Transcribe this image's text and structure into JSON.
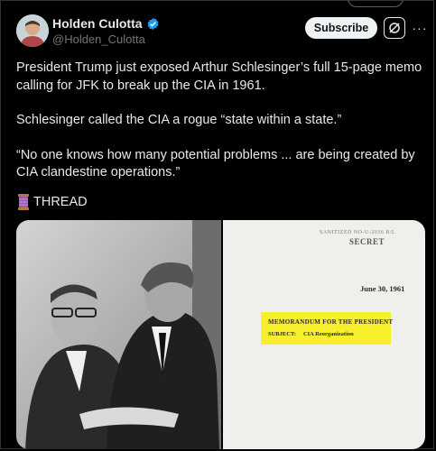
{
  "header": {
    "display_name": "Holden Culotta",
    "handle": "@Holden_Culotta",
    "subscribe_label": "Subscribe",
    "more_label": "···"
  },
  "tweet": {
    "paragraphs": [
      "President Trump just exposed Arthur Schlesinger’s full 15-page memo calling for JFK to break up the CIA in 1961.",
      "Schlesinger called the CIA a rogue “state within a state.”",
      "“No one knows how many potential problems ... are being created by CIA clandestine operations.”"
    ],
    "thread_label": "THREAD"
  },
  "document": {
    "stamp": "SANITIZED  NO-U-2016  B/L",
    "classification": "SECRET",
    "date": "June 30, 1961",
    "memo_heading": "MEMORANDUM FOR THE PRESIDENT",
    "subject_label": "SUBJECT:",
    "subject_value": "CIA Reorganization"
  },
  "colors": {
    "background": "#000000",
    "text": "#e7e9ea",
    "secondary_text": "#71767b",
    "verified": "#1d9bf0",
    "highlight": "#f7ef2c"
  }
}
